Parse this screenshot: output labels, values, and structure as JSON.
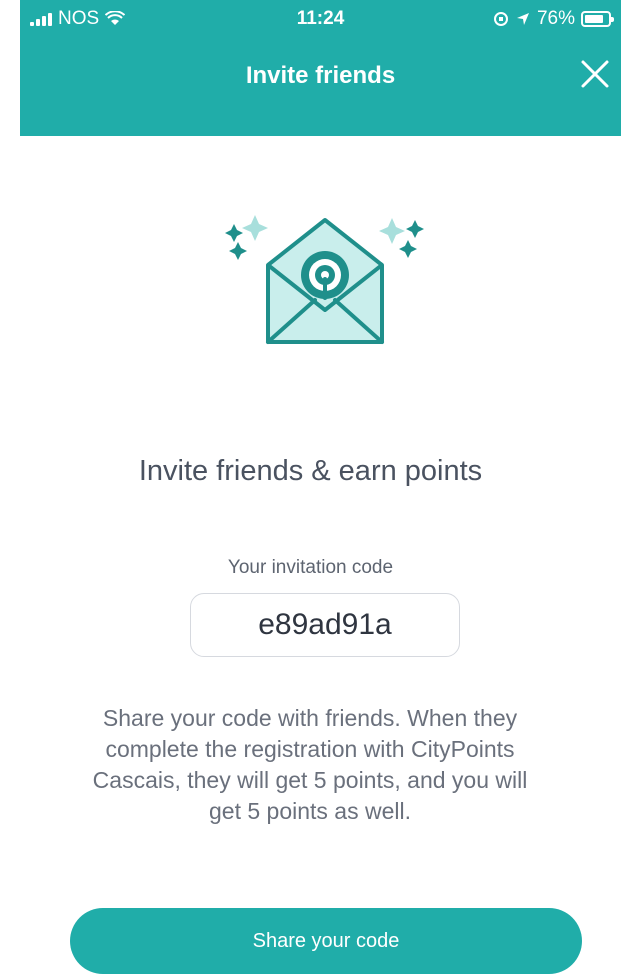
{
  "status_bar": {
    "carrier": "NOS",
    "time": "11:24",
    "battery": "76%"
  },
  "header": {
    "title": "Invite friends",
    "close_icon": "close-icon"
  },
  "illustration": {
    "icon": "envelope-icon"
  },
  "content": {
    "headline": "Invite friends & earn points",
    "code_label": "Your invitation code",
    "code_value": "e89ad91a",
    "description": "Share your code with friends. When they complete the registration with CityPoints Cascais, they will get 5 points, and you will get 5 points as well."
  },
  "actions": {
    "share_label": "Share your code"
  },
  "colors": {
    "accent": "#20ADA9",
    "text_primary": "#4a5260",
    "text_secondary": "#6a707c"
  }
}
